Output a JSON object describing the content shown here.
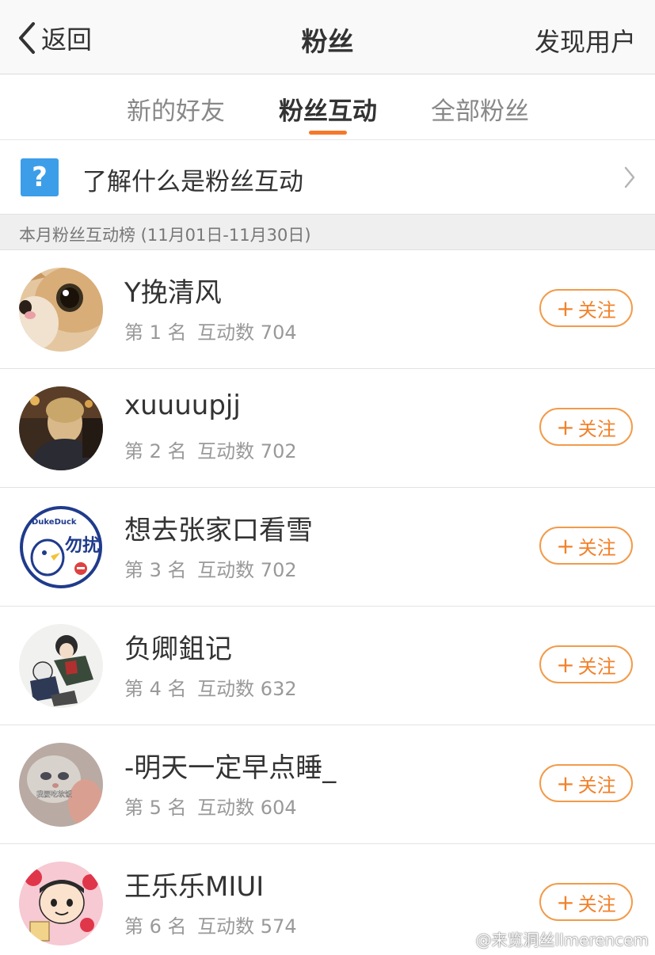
{
  "nav": {
    "back_label": "返回",
    "title": "粉丝",
    "discover_label": "发现用户"
  },
  "tabs": [
    {
      "label": "新的好友",
      "active": false
    },
    {
      "label": "粉丝互动",
      "active": true
    },
    {
      "label": "全部粉丝",
      "active": false
    }
  ],
  "info": {
    "icon": "?",
    "text": "了解什么是粉丝互动"
  },
  "section": {
    "label": "本月粉丝互动榜 (11月01日-11月30日)"
  },
  "fans": [
    {
      "name": "Y挽清风",
      "rank": "第 1 名",
      "count": "互动数 704",
      "follow": "关注"
    },
    {
      "name": "xuuuupjj",
      "rank": "第 2 名",
      "count": "互动数 702",
      "follow": "关注"
    },
    {
      "name": "想去张家口看雪",
      "rank": "第 3 名",
      "count": "互动数 702",
      "follow": "关注"
    },
    {
      "name": "负卿鉏记",
      "rank": "第 4 名",
      "count": "互动数 632",
      "follow": "关注"
    },
    {
      "name": "-明天一定早点睡_",
      "rank": "第 5 名",
      "count": "互动数 604",
      "follow": "关注"
    },
    {
      "name": "王乐乐MIUI",
      "rank": "第 6 名",
      "count": "互动数 574",
      "follow": "关注"
    }
  ],
  "avatar_texts": {
    "duck_brand": "DukeDuck",
    "duck_chars": "勿扰",
    "cat_caption": "我要吃软饭"
  },
  "watermark": "@来览洞丝llmerencem",
  "colors": {
    "accent": "#f6782a",
    "follow_border": "#f29b4a",
    "question_icon": "#3c9ee8"
  }
}
